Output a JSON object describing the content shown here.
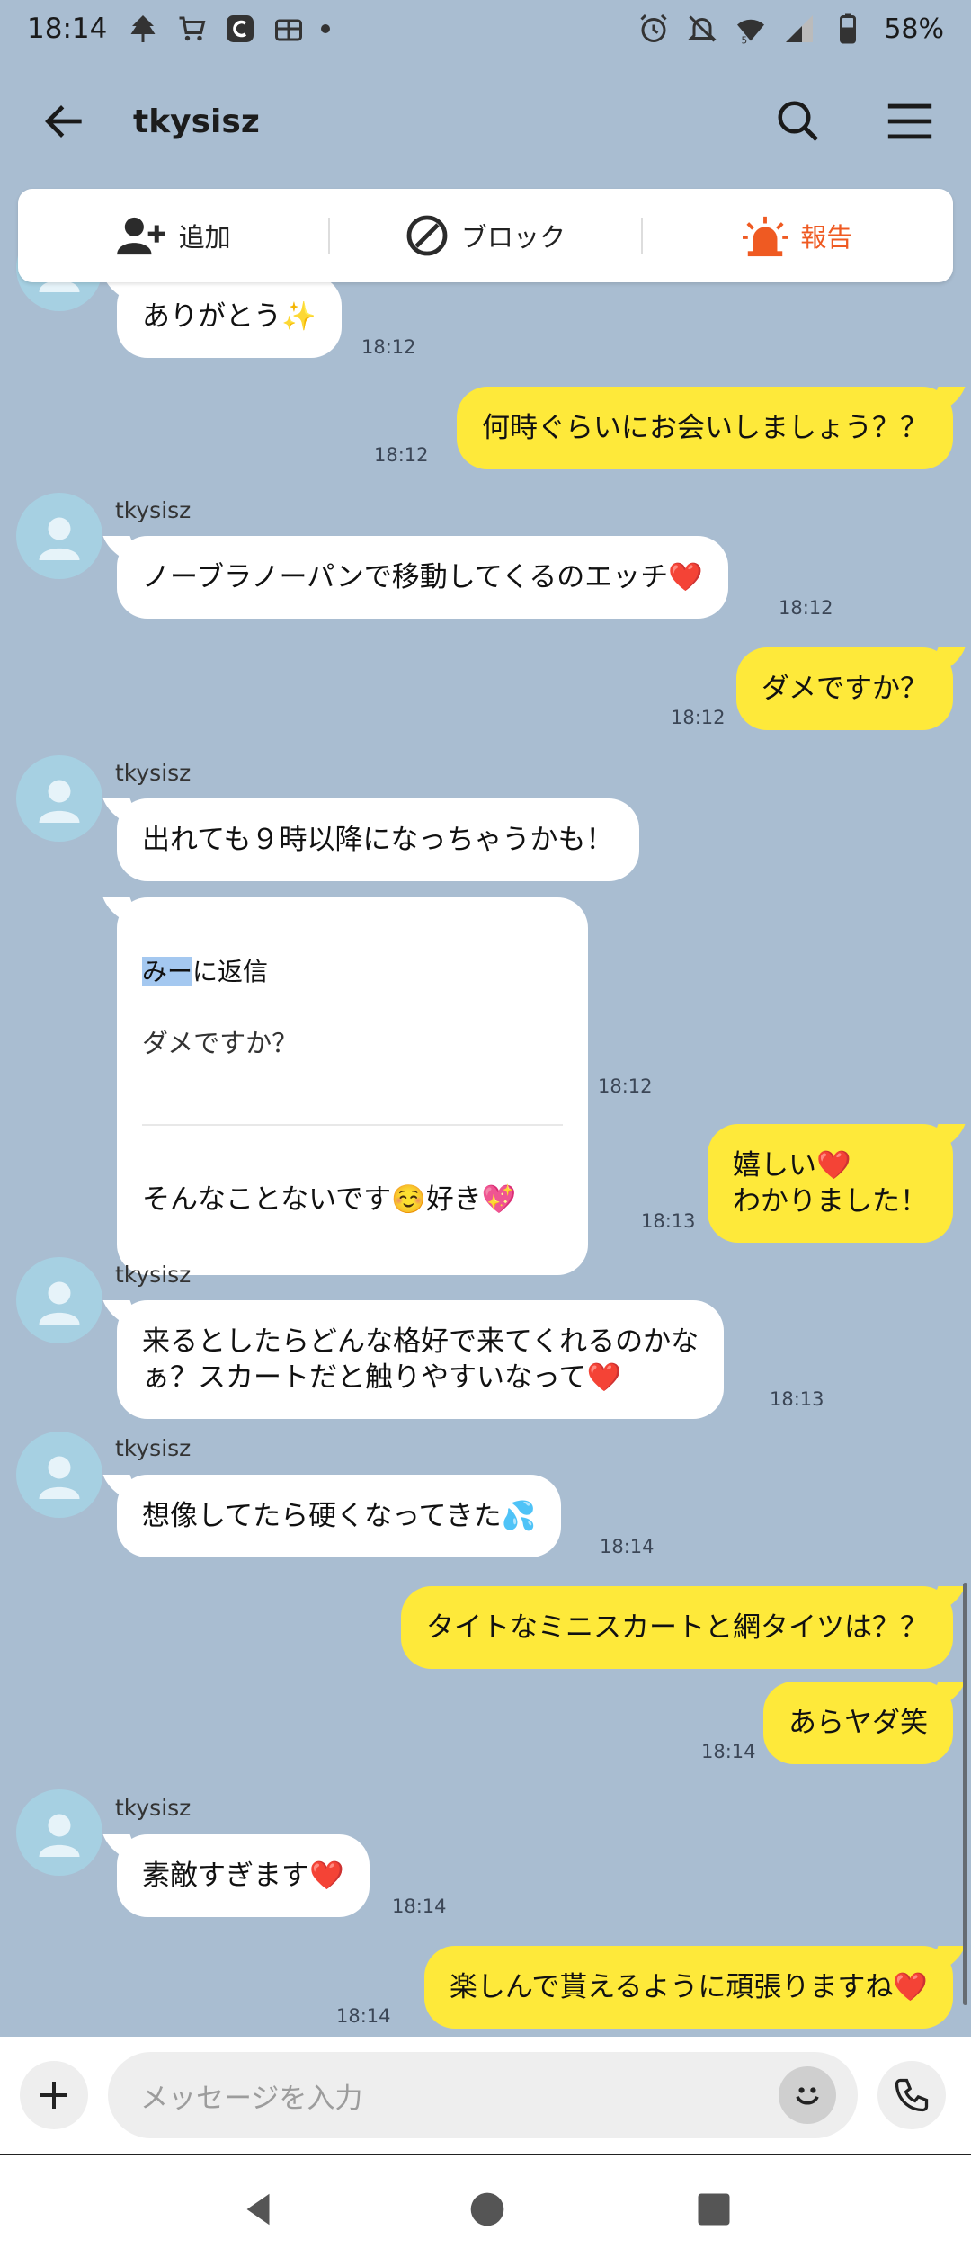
{
  "status_bar": {
    "time": "18:14",
    "battery": "58%",
    "network_badge": "5"
  },
  "header": {
    "title": "tkysisz"
  },
  "actions": {
    "add": "追加",
    "block": "ブロック",
    "report": "報告",
    "report_color": "#ef5a22"
  },
  "colors": {
    "background": "#a9bdd1",
    "incoming_bubble": "#ffffff",
    "outgoing_bubble": "#fee93a",
    "avatar": "#a6d0e2"
  },
  "messages": [
    {
      "dir": "in",
      "text": "ありがとう✨",
      "time": "18:12"
    },
    {
      "dir": "out",
      "text": "何時ぐらいにお会いしましょう？？",
      "time": "18:12"
    },
    {
      "dir": "in",
      "sender": "tkysisz",
      "text": "ノーブラノーパンで移動してくるのエッチ❤️",
      "time": "18:12"
    },
    {
      "dir": "out",
      "text": "ダメですか？",
      "time": "18:12"
    },
    {
      "dir": "in",
      "sender": "tkysisz",
      "text": "出れても９時以降になっちゃうかも！"
    },
    {
      "dir": "in",
      "reply_to": "みー",
      "reply_suffix": "に返信",
      "quoted": "ダメですか？",
      "text": "そんなことないです☺️好き💖",
      "time": "18:12"
    },
    {
      "dir": "out",
      "text": "嬉しい❤️\nわかりました！",
      "time": "18:13"
    },
    {
      "dir": "in",
      "sender": "tkysisz",
      "text": "来るとしたらどんな格好で来てくれるのかな\nぁ？スカートだと触りやすいなって❤️",
      "time": "18:13"
    },
    {
      "dir": "in",
      "sender": "tkysisz",
      "text": "想像してたら硬くなってきた💦",
      "time": "18:14"
    },
    {
      "dir": "out",
      "text": "タイトなミニスカートと網タイツは？？"
    },
    {
      "dir": "out",
      "text": "あらヤダ笑",
      "time": "18:14"
    },
    {
      "dir": "in",
      "sender": "tkysisz",
      "text": "素敵すぎます❤️",
      "time": "18:14"
    },
    {
      "dir": "out",
      "text": "楽しんで貰えるように頑張りますね❤️",
      "time": "18:14"
    }
  ],
  "input": {
    "placeholder": "メッセージを入力"
  }
}
